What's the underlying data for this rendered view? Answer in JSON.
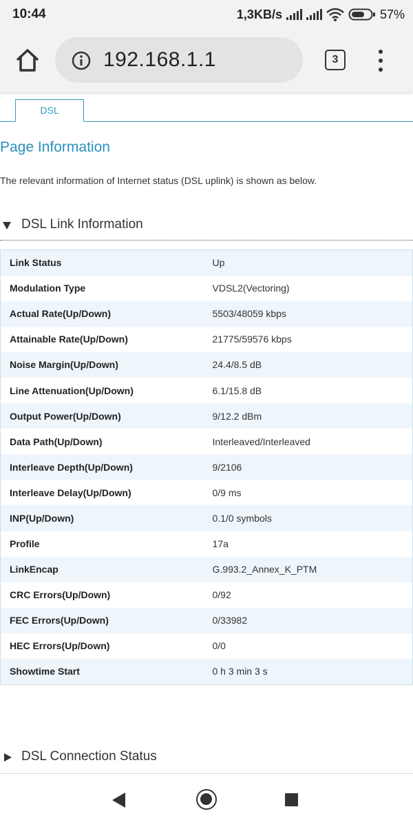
{
  "status_bar": {
    "time": "10:44",
    "net_speed": "1,3KB/s",
    "battery": "57%"
  },
  "browser": {
    "url": "192.168.1.1",
    "tab_count": "3",
    "icons": [
      "home-icon",
      "info-icon",
      "tabs-icon",
      "menu-icon"
    ]
  },
  "page": {
    "tab_label": "DSL",
    "title": "Page Information",
    "description": "The relevant information of Internet status (DSL uplink) is shown as below.",
    "section_link": "DSL Link Information",
    "section_connection": "DSL Connection Status",
    "accent_color": "#2b8fbd"
  },
  "link_info": [
    {
      "label": "Link Status",
      "value": "Up"
    },
    {
      "label": "Modulation Type",
      "value": "VDSL2(Vectoring)"
    },
    {
      "label": "Actual Rate(Up/Down)",
      "value": "5503/48059 kbps"
    },
    {
      "label": "Attainable Rate(Up/Down)",
      "value": "21775/59576 kbps"
    },
    {
      "label": "Noise Margin(Up/Down)",
      "value": "24.4/8.5 dB"
    },
    {
      "label": "Line Attenuation(Up/Down)",
      "value": "6.1/15.8 dB"
    },
    {
      "label": "Output Power(Up/Down)",
      "value": "9/12.2 dBm"
    },
    {
      "label": "Data Path(Up/Down)",
      "value": "Interleaved/Interleaved"
    },
    {
      "label": "Interleave Depth(Up/Down)",
      "value": "9/2106"
    },
    {
      "label": "Interleave Delay(Up/Down)",
      "value": "0/9 ms"
    },
    {
      "label": "INP(Up/Down)",
      "value": "0.1/0 symbols"
    },
    {
      "label": "Profile",
      "value": "17a"
    },
    {
      "label": "LinkEncap",
      "value": "G.993.2_Annex_K_PTM"
    },
    {
      "label": "CRC Errors(Up/Down)",
      "value": "0/92"
    },
    {
      "label": "FEC Errors(Up/Down)",
      "value": "0/33982"
    },
    {
      "label": "HEC Errors(Up/Down)",
      "value": "0/0"
    },
    {
      "label": "Showtime Start",
      "value": "0 h 3 min 3 s"
    }
  ]
}
